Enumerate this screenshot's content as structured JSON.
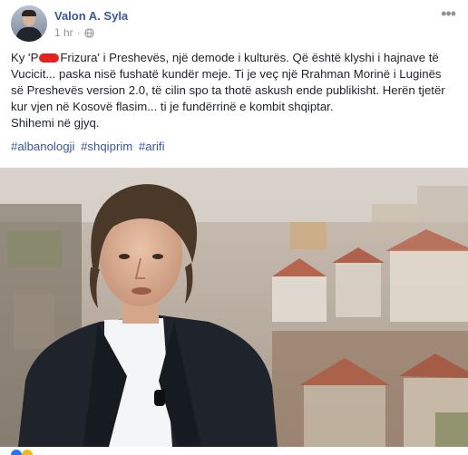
{
  "post": {
    "author": "Valon A. Syla",
    "time": "1 hr",
    "privacy_icon": "globe-icon",
    "more_icon": "ellipsis-icon",
    "text_before_redaction": "Ky 'P",
    "text_after_redaction": "Frizura' i Preshevës, një demode i kulturës. Që është klyshi i hajnave të Vucicit... paska nisë fushatë kundër meje. Ti je veç një Rrahman Morinë i Luginës së Preshevës version 2.0, të cilin spo ta thotë askush ende publikisht. Herën tjetër kur vjen në Kosovë flasim... ti je fundërrinë e kombit shqiptar.",
    "text_line_last": "Shihemi në gjyq.",
    "hashtags": [
      "#albanologji",
      "#shqiprim",
      "#arifi"
    ],
    "link_color": "#385898"
  }
}
